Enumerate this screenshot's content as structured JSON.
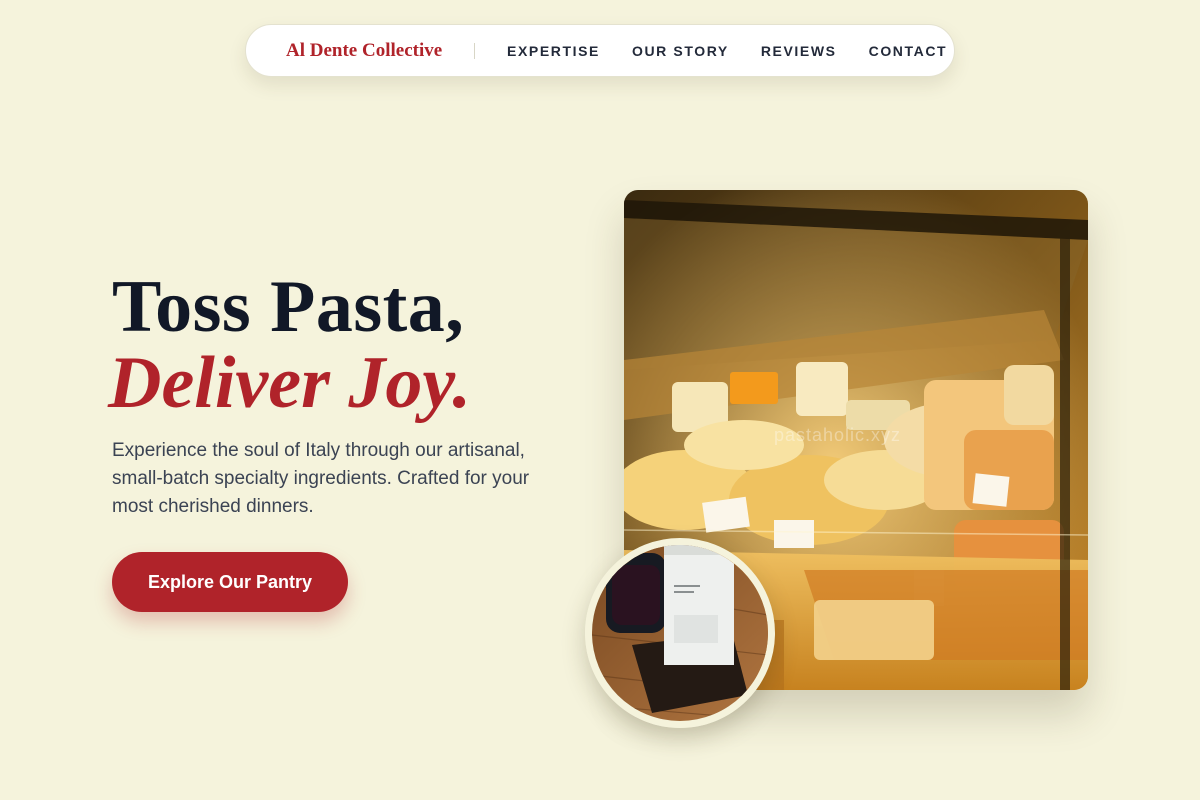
{
  "brand": "Al Dente Collective",
  "nav": {
    "links": [
      "EXPERTISE",
      "OUR STORY",
      "REVIEWS",
      "CONTACT"
    ]
  },
  "hero": {
    "headline_line1": "Toss Pasta,",
    "headline_line2": "Deliver Joy.",
    "lede": "Experience the soul of Italy through our artisanal, small-batch specialty ingredients. Crafted for your most cherished dinners.",
    "cta_label": "Explore Our Pantry",
    "photo_watermark": "pastaholic.xyz"
  },
  "colors": {
    "background": "#f5f3dc",
    "accent": "#b0232a",
    "heading": "#111827",
    "body_text": "#3b4353"
  }
}
